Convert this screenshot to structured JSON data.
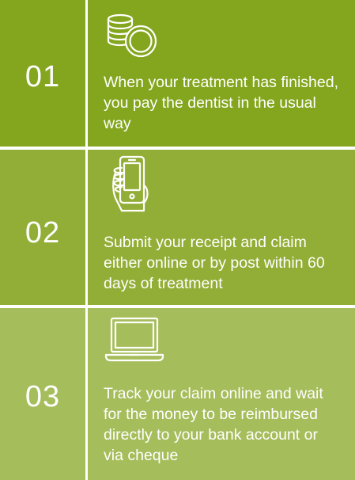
{
  "steps": [
    {
      "number": "01",
      "icon": "coins-icon",
      "text": "When your treatment has finished, you pay the dentist in the usual way"
    },
    {
      "number": "02",
      "icon": "smartphone-hand-icon",
      "text": "Submit your receipt and claim either online or by post within 60 days of treatment"
    },
    {
      "number": "03",
      "icon": "laptop-icon",
      "text": "Track your claim online and wait for the money to be reimbursed directly to your bank account or via cheque"
    }
  ],
  "colors": {
    "step1_bg": "#84a61e",
    "step2_bg": "#93ae37",
    "step3_bg": "#a6bd5b",
    "foreground": "#ffffff"
  }
}
